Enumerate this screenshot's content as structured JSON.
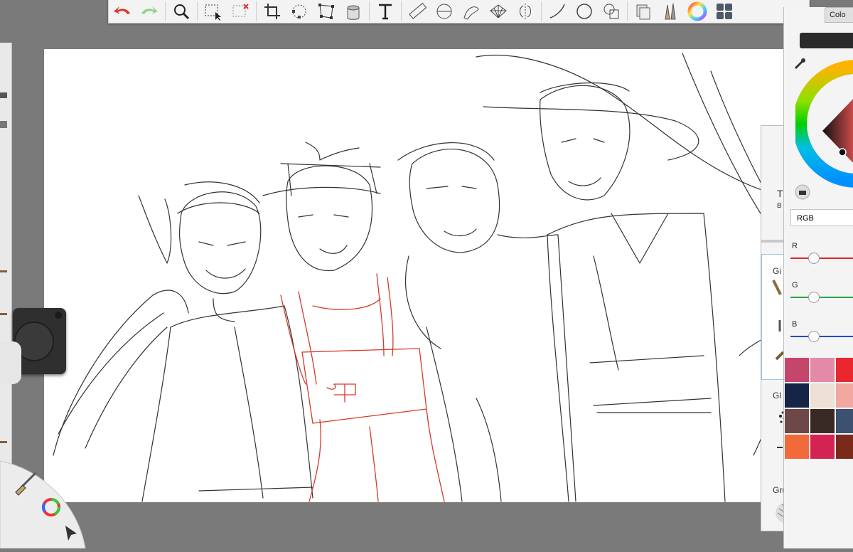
{
  "panel": {
    "color_tab": "Colo",
    "color_mode": "RGB",
    "sliders": [
      "R",
      "G",
      "B"
    ],
    "slider_colors": [
      "#d9262a",
      "#28a745",
      "#2548d6"
    ],
    "swatches": [
      "#c4466a",
      "#e38aa8",
      "#e8272f",
      "#152447",
      "#efe0d6",
      "#f2a8a0",
      "#6e4848",
      "#3a2a26",
      "#3c5070",
      "#f26a3a",
      "#d42254",
      "#7a2a1a"
    ],
    "current_color": "#2b2b2b",
    "brush_set_label": "Grunge Texture",
    "brush_labels": [
      "T",
      "B",
      "Gi",
      "Gl"
    ]
  },
  "toolbar": {
    "icons": [
      "undo-icon",
      "redo-icon",
      "zoom-icon",
      "select-icon",
      "lasso-select-icon",
      "crop-icon",
      "transform-icon",
      "distort-icon",
      "fill-icon",
      "text-icon",
      "ruler-icon",
      "ellipse-guide-icon",
      "french-curve-icon",
      "perspective-icon",
      "symmetry-icon",
      "stroke-icon",
      "shape-icon",
      "layers-icon",
      "brushes-icon",
      "color-icon",
      "layout-icon"
    ]
  }
}
